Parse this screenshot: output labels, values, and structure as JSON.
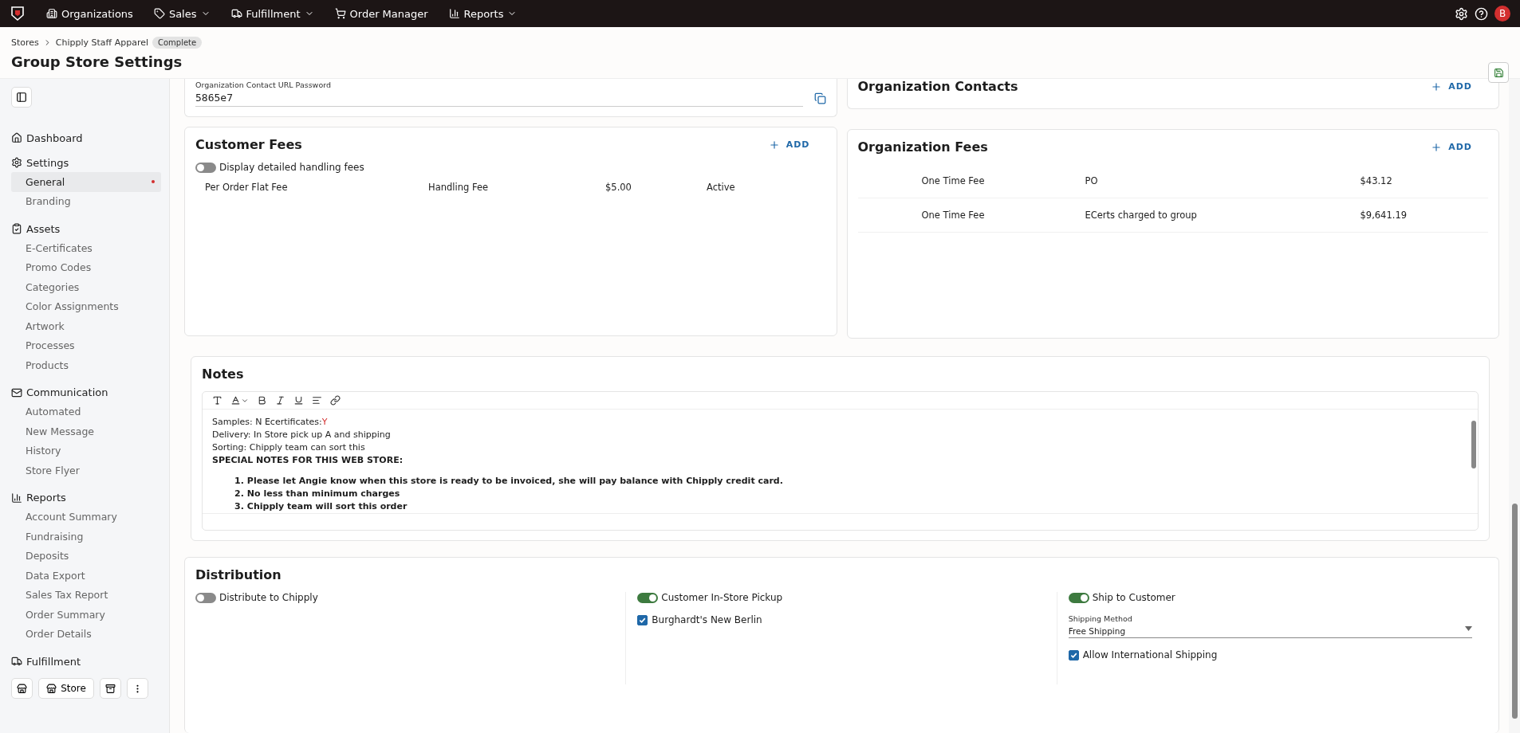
{
  "top_nav": {
    "items": [
      {
        "label": "Organizations",
        "dropdown": false
      },
      {
        "label": "Sales",
        "dropdown": true
      },
      {
        "label": "Fulfillment",
        "dropdown": true
      },
      {
        "label": "Order Manager",
        "dropdown": false
      },
      {
        "label": "Reports",
        "dropdown": true
      }
    ],
    "avatar": "B"
  },
  "breadcrumb": {
    "items": [
      "Stores",
      "Chipply Staff Apparel"
    ],
    "status": "Complete"
  },
  "page_title": "Group Store Settings",
  "sidebar": {
    "sections": [
      {
        "label": "Dashboard"
      },
      {
        "label": "Settings",
        "items": [
          {
            "label": "General",
            "selected": true,
            "flagged": true
          },
          {
            "label": "Branding",
            "selected": false,
            "flagged": false
          }
        ]
      },
      {
        "label": "Assets",
        "items": [
          {
            "label": "E-Certificates",
            "selected": false,
            "flagged": false
          },
          {
            "label": "Promo Codes",
            "selected": false,
            "flagged": false
          },
          {
            "label": "Categories",
            "selected": false,
            "flagged": false
          },
          {
            "label": "Color Assignments",
            "selected": false,
            "flagged": false
          },
          {
            "label": "Artwork",
            "selected": false,
            "flagged": false
          },
          {
            "label": "Processes",
            "selected": false,
            "flagged": false
          },
          {
            "label": "Products",
            "selected": false,
            "flagged": false
          }
        ]
      },
      {
        "label": "Communication",
        "items": [
          {
            "label": "Automated",
            "selected": false,
            "flagged": false
          },
          {
            "label": "New Message",
            "selected": false,
            "flagged": false
          },
          {
            "label": "History",
            "selected": false,
            "flagged": false
          },
          {
            "label": "Store Flyer",
            "selected": false,
            "flagged": false
          }
        ]
      },
      {
        "label": "Reports",
        "items": [
          {
            "label": "Account Summary",
            "selected": false,
            "flagged": false
          },
          {
            "label": "Fundraising",
            "selected": false,
            "flagged": false
          },
          {
            "label": "Deposits",
            "selected": false,
            "flagged": false
          },
          {
            "label": "Data Export",
            "selected": false,
            "flagged": false
          },
          {
            "label": "Sales Tax Report",
            "selected": false,
            "flagged": false
          },
          {
            "label": "Order Summary",
            "selected": false,
            "flagged": false
          },
          {
            "label": "Order Details",
            "selected": false,
            "flagged": false
          }
        ]
      },
      {
        "label": "Fulfillment"
      }
    ],
    "store_button": "Store"
  },
  "password_field": {
    "label": "Organization Contact URL Password",
    "value": "5865e7"
  },
  "organization_contacts": {
    "title": "Organization Contacts",
    "add": "ADD"
  },
  "customer_fees": {
    "title": "Customer Fees",
    "add": "ADD",
    "toggle": {
      "label": "Display detailed handling fees",
      "on": false
    },
    "rows": [
      [
        "Per Order Flat Fee",
        "Handling Fee",
        "$5.00",
        "Active"
      ]
    ]
  },
  "organization_fees": {
    "title": "Organization Fees",
    "add": "ADD",
    "rows": [
      [
        "One Time Fee",
        "PO",
        "$43.12"
      ],
      [
        "One Time Fee",
        "ECerts charged to group",
        "$9,641.19"
      ]
    ]
  },
  "notes": {
    "title": "Notes",
    "lines": [
      {
        "kind": "plain",
        "text": "Samples: N  Ecertificates:",
        "flag": "Y"
      },
      {
        "kind": "plain",
        "text": "Delivery:  In Store pick up A and shipping"
      },
      {
        "kind": "plain",
        "text": "Sorting:  Chipply team can sort this"
      },
      {
        "kind": "bold",
        "text": "SPECIAL NOTES FOR THIS WEB STORE:"
      },
      {
        "kind": "numbered",
        "marker": "1.",
        "text": "Please let Angie know when this store is ready to be invoiced, she will pay balance with Chipply credit card."
      },
      {
        "kind": "numbered",
        "marker": "2.",
        "text": "No less than minimum charges"
      },
      {
        "kind": "numbered",
        "marker": "3.",
        "text": "Chipply team will sort this order"
      }
    ]
  },
  "distribution": {
    "title": "Distribution",
    "columns": [
      {
        "toggle": {
          "label": "Distribute to Chipply",
          "on": false
        }
      },
      {
        "toggle": {
          "label": "Customer In-Store Pickup",
          "on": true
        },
        "checkbox": {
          "label": "Burghardt's New Berlin",
          "checked": true
        }
      },
      {
        "toggle": {
          "label": "Ship to Customer",
          "on": true
        },
        "select": {
          "label": "Shipping Method",
          "value": "Free Shipping"
        },
        "checkbox": {
          "label": "Allow International Shipping",
          "checked": true
        }
      }
    ]
  }
}
